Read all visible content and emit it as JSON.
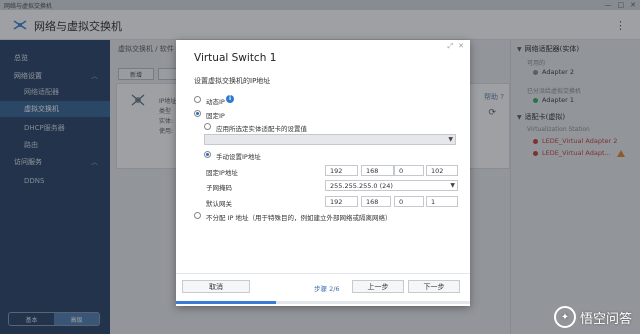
{
  "window": {
    "title": "网络与虚拟交换机",
    "min": "—",
    "max": "□",
    "close": "✕"
  },
  "app": {
    "title": "网络与虚拟交换机",
    "menu": "⋮"
  },
  "sidebar": {
    "items": [
      {
        "label": "总览",
        "level": "top"
      },
      {
        "label": "网络设置",
        "level": "top",
        "expandable": true
      },
      {
        "label": "网络适配器",
        "level": "sub"
      },
      {
        "label": "虚拟交换机",
        "level": "sub",
        "active": true
      },
      {
        "label": "DHCP服务器",
        "level": "sub"
      },
      {
        "label": "路由",
        "level": "sub"
      },
      {
        "label": "访问服务",
        "level": "top",
        "expandable": true
      },
      {
        "label": "DDNS",
        "level": "sub"
      }
    ],
    "mode": {
      "basic": "基本",
      "advanced": "高级",
      "selected": "advanced"
    }
  },
  "main": {
    "breadcrumb": "虚拟交换机 / 软件",
    "buttons": {
      "add": "新增",
      "edit": ""
    },
    "card_labels": [
      "IP地址",
      "类型",
      "实体:",
      "使用:"
    ],
    "help": "帮助 ?",
    "refresh": "⟳"
  },
  "right_panel": {
    "physical": {
      "title": "网络适配器(实体)",
      "available_label": "可用的",
      "available": [
        "Adapter 2"
      ],
      "used_label": "已分派给虚拟交换机",
      "used": [
        "Adapter 1"
      ]
    },
    "virtual": {
      "title": "适配卡(虚拟)",
      "station_label": "Virtualization Station",
      "items": [
        "LEDE_Virtual Adapter 2",
        "LEDE_Virtual Adapt..."
      ]
    }
  },
  "dialog": {
    "title": "Virtual Switch 1",
    "controls": {
      "resize": "⤢",
      "close": "✕"
    },
    "subtitle": "设置虚拟交换机的IP地址",
    "options": {
      "dynamic": "动态IP",
      "static": "固定IP",
      "apply_physical": "应用所选定实体适配卡的设置值",
      "manual": "手动设置IP地址",
      "none": "不分配 IP 地址（用于特殊目的，例如建立外部网络或隔离网络）"
    },
    "fields": {
      "ip_label": "固定IP地址",
      "ip": [
        "192",
        "168",
        "0",
        "102"
      ],
      "mask_label": "子网掩码",
      "mask": "255.255.255.0 (24)",
      "gw_label": "默认网关",
      "gw": [
        "192",
        "168",
        "0",
        "1"
      ]
    },
    "footer": {
      "cancel": "取消",
      "step": "步骤 2/6",
      "prev": "上一步",
      "next": "下一步",
      "progress": 0.34
    }
  },
  "watermark": "悟空问答"
}
